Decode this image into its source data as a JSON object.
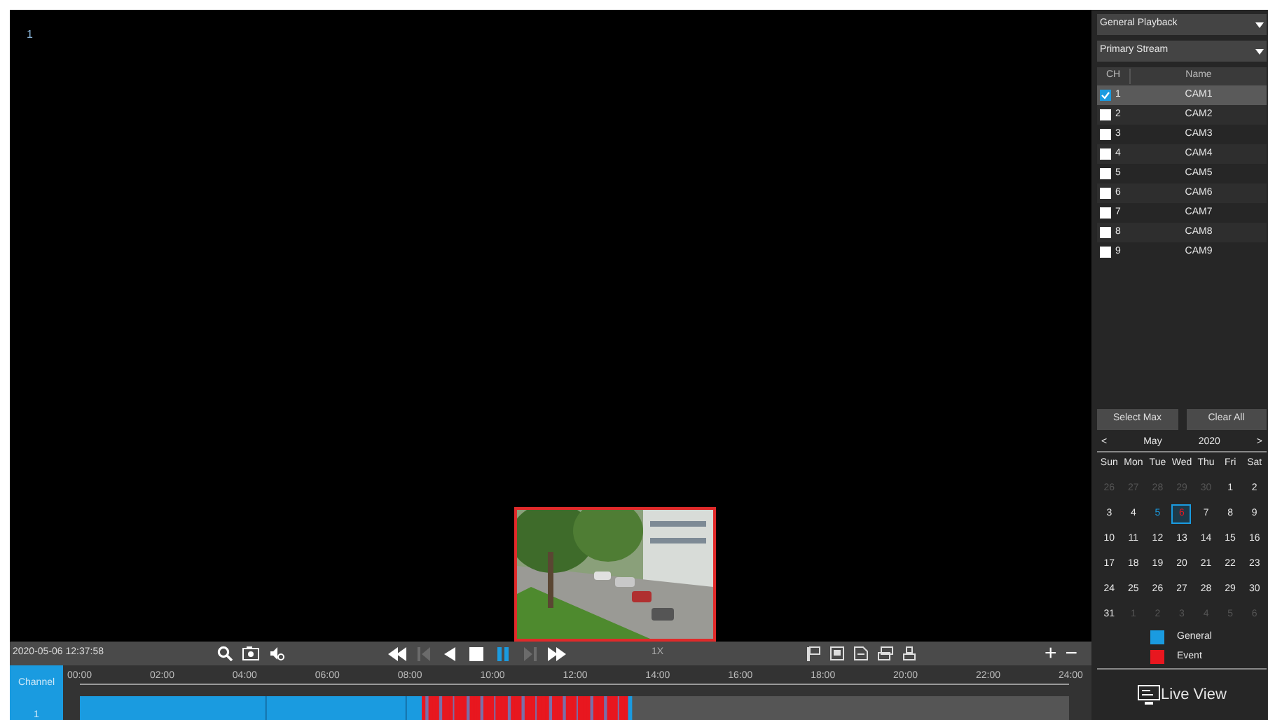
{
  "video": {
    "channel_label": "1"
  },
  "playback_mode": "General Playback",
  "stream": "Primary Stream",
  "channel_table": {
    "columns": [
      "CH",
      "Name"
    ],
    "rows": [
      {
        "ch": "1",
        "name": "CAM1",
        "checked": true,
        "selected": true
      },
      {
        "ch": "2",
        "name": "CAM2",
        "checked": false,
        "selected": false
      },
      {
        "ch": "3",
        "name": "CAM3",
        "checked": false,
        "selected": false
      },
      {
        "ch": "4",
        "name": "CAM4",
        "checked": false,
        "selected": false
      },
      {
        "ch": "5",
        "name": "CAM5",
        "checked": false,
        "selected": false
      },
      {
        "ch": "6",
        "name": "CAM6",
        "checked": false,
        "selected": false
      },
      {
        "ch": "7",
        "name": "CAM7",
        "checked": false,
        "selected": false
      },
      {
        "ch": "8",
        "name": "CAM8",
        "checked": false,
        "selected": false
      },
      {
        "ch": "9",
        "name": "CAM9",
        "checked": false,
        "selected": false
      }
    ]
  },
  "buttons": [
    "Select Max",
    "Clear All"
  ],
  "calendar": {
    "prev": "<",
    "month": "May",
    "year": "2020",
    "next": ">",
    "weekdays": [
      "Sun",
      "Mon",
      "Tue",
      "Wed",
      "Thu",
      "Fri",
      "Sat"
    ],
    "days": [
      {
        "label": "26",
        "kind": "outside",
        "selected": false
      },
      {
        "label": "27",
        "kind": "outside",
        "selected": false
      },
      {
        "label": "28",
        "kind": "outside",
        "selected": false
      },
      {
        "label": "29",
        "kind": "outside",
        "selected": false
      },
      {
        "label": "30",
        "kind": "outside",
        "selected": false
      },
      {
        "label": "1",
        "kind": "plain",
        "selected": false
      },
      {
        "label": "2",
        "kind": "plain",
        "selected": false
      },
      {
        "label": "3",
        "kind": "plain",
        "selected": false
      },
      {
        "label": "4",
        "kind": "plain",
        "selected": false
      },
      {
        "label": "5",
        "kind": "general",
        "selected": false
      },
      {
        "label": "6",
        "kind": "event",
        "selected": true
      },
      {
        "label": "7",
        "kind": "plain",
        "selected": false
      },
      {
        "label": "8",
        "kind": "plain",
        "selected": false
      },
      {
        "label": "9",
        "kind": "plain",
        "selected": false
      },
      {
        "label": "10",
        "kind": "plain",
        "selected": false
      },
      {
        "label": "11",
        "kind": "plain",
        "selected": false
      },
      {
        "label": "12",
        "kind": "plain",
        "selected": false
      },
      {
        "label": "13",
        "kind": "plain",
        "selected": false
      },
      {
        "label": "14",
        "kind": "plain",
        "selected": false
      },
      {
        "label": "15",
        "kind": "plain",
        "selected": false
      },
      {
        "label": "16",
        "kind": "plain",
        "selected": false
      },
      {
        "label": "17",
        "kind": "plain",
        "selected": false
      },
      {
        "label": "18",
        "kind": "plain",
        "selected": false
      },
      {
        "label": "19",
        "kind": "plain",
        "selected": false
      },
      {
        "label": "20",
        "kind": "plain",
        "selected": false
      },
      {
        "label": "21",
        "kind": "plain",
        "selected": false
      },
      {
        "label": "22",
        "kind": "plain",
        "selected": false
      },
      {
        "label": "23",
        "kind": "plain",
        "selected": false
      },
      {
        "label": "24",
        "kind": "plain",
        "selected": false
      },
      {
        "label": "25",
        "kind": "plain",
        "selected": false
      },
      {
        "label": "26",
        "kind": "plain",
        "selected": false
      },
      {
        "label": "27",
        "kind": "plain",
        "selected": false
      },
      {
        "label": "28",
        "kind": "plain",
        "selected": false
      },
      {
        "label": "29",
        "kind": "plain",
        "selected": false
      },
      {
        "label": "30",
        "kind": "plain",
        "selected": false
      },
      {
        "label": "31",
        "kind": "plain",
        "selected": false
      },
      {
        "label": "1",
        "kind": "outside",
        "selected": false
      },
      {
        "label": "2",
        "kind": "outside",
        "selected": false
      },
      {
        "label": "3",
        "kind": "outside",
        "selected": false
      },
      {
        "label": "4",
        "kind": "outside",
        "selected": false
      },
      {
        "label": "5",
        "kind": "outside",
        "selected": false
      },
      {
        "label": "6",
        "kind": "outside",
        "selected": false
      }
    ]
  },
  "legend": [
    {
      "label": "General",
      "color": "#1a9be0"
    },
    {
      "label": "Event",
      "color": "#e8171f"
    }
  ],
  "live_view": "Live View",
  "toolbar": {
    "timestamp": "2020-05-06 12:37:58",
    "speed": "1X",
    "playback_controls": [
      {
        "kind": "fast-rewind",
        "disabled": false,
        "selected": false
      },
      {
        "kind": "frame-back",
        "disabled": true,
        "selected": false
      },
      {
        "kind": "reverse",
        "disabled": false,
        "selected": false
      },
      {
        "kind": "stop",
        "disabled": false,
        "selected": false
      },
      {
        "kind": "pause",
        "disabled": false,
        "selected": true
      },
      {
        "kind": "frame-forward",
        "disabled": true,
        "selected": false
      },
      {
        "kind": "fast-forward",
        "disabled": false,
        "selected": false
      }
    ],
    "zoom_in": "+",
    "zoom_out": "−"
  },
  "timeline": {
    "header": "Channel",
    "channel": "1",
    "ticks": [
      "00:00",
      "02:00",
      "04:00",
      "06:00",
      "08:00",
      "10:00",
      "12:00",
      "14:00",
      "16:00",
      "18:00",
      "20:00",
      "22:00",
      "24:00"
    ]
  }
}
